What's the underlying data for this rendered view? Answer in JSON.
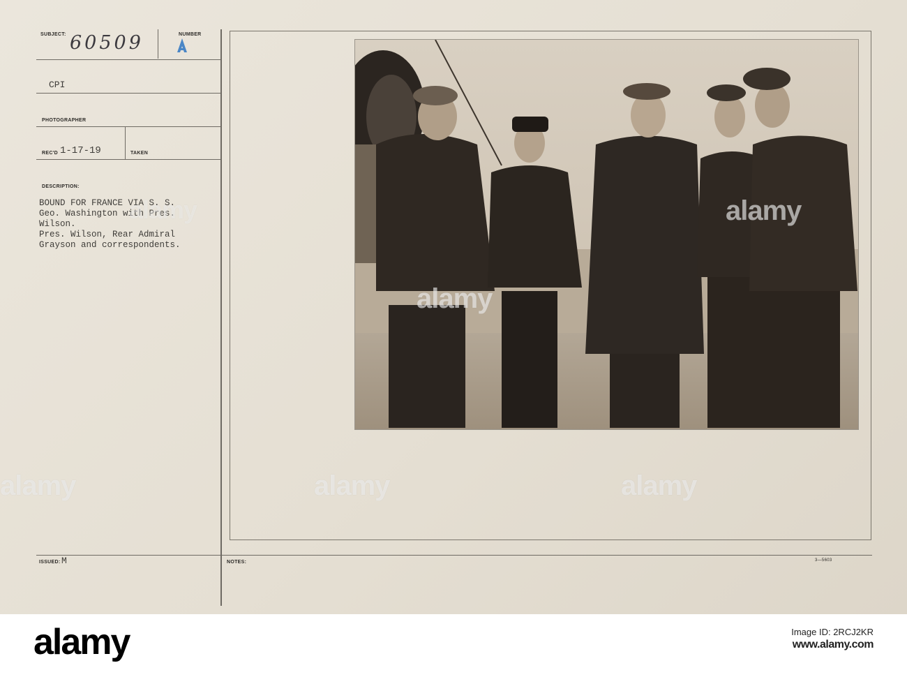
{
  "record": {
    "subject_label": "SUBJECT:",
    "subject_value": "60509",
    "number_label": "NUMBER",
    "number_value": "A",
    "agency": "CPI",
    "photographer_label": "PHOTOGRAPHER",
    "recd_label": "REC'D",
    "recd_value": "1-17-19",
    "taken_label": "TAKEN",
    "description_label": "DESCRIPTION:",
    "description_lines": [
      "BOUND FOR FRANCE VIA S. S.",
      "Geo. Washington with Pres.",
      "Wilson.",
      "Pres. Wilson, Rear Admiral",
      "Grayson and correspondents."
    ],
    "issued_label": "ISSUED:",
    "issued_value": "M",
    "notes_label": "NOTES:",
    "form_code": "3—5603"
  },
  "watermarks": {
    "text": "alamy"
  },
  "footer": {
    "logo": "alamy",
    "image_id": "Image ID: 2RCJ2KR",
    "url": "www.alamy.com"
  },
  "colors": {
    "card": "#e6e0d4",
    "ink": "#3f3d39",
    "rule": "#6e6a63",
    "photo_sepia": "#a79987"
  }
}
